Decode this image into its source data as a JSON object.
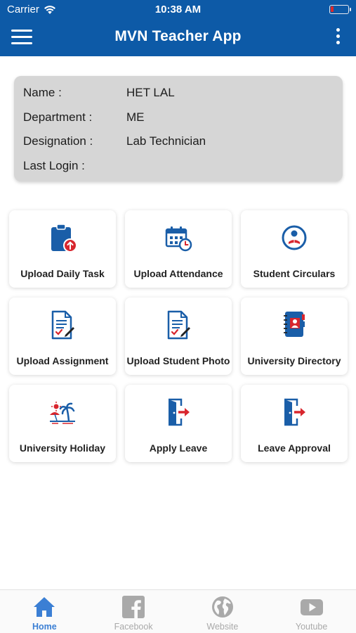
{
  "status": {
    "carrier": "Carrier",
    "time": "10:38 AM"
  },
  "header": {
    "title": "MVN Teacher App"
  },
  "profile": {
    "rows": [
      {
        "label": "Name :",
        "value": "HET LAL"
      },
      {
        "label": "Department :",
        "value": "ME"
      },
      {
        "label": "Designation :",
        "value": "Lab Technician"
      },
      {
        "label": "Last Login :",
        "value": ""
      }
    ]
  },
  "tiles": [
    {
      "label": "Upload Daily Task",
      "icon": "clipboard-upload-icon"
    },
    {
      "label": "Upload Attendance",
      "icon": "calendar-clock-icon"
    },
    {
      "label": "Student Circulars",
      "icon": "student-reading-icon"
    },
    {
      "label": "Upload Assignment",
      "icon": "document-edit-icon"
    },
    {
      "label": "Upload Student Photo",
      "icon": "document-edit-icon"
    },
    {
      "label": "University Directory",
      "icon": "directory-book-icon"
    },
    {
      "label": "University Holiday",
      "icon": "beach-holiday-icon"
    },
    {
      "label": "Apply Leave",
      "icon": "exit-door-icon"
    },
    {
      "label": "Leave Approval",
      "icon": "exit-door-icon"
    }
  ],
  "tabs": [
    {
      "label": "Home",
      "icon": "home-icon",
      "active": true
    },
    {
      "label": "Facebook",
      "icon": "facebook-icon",
      "active": false
    },
    {
      "label": "Website",
      "icon": "globe-icon",
      "active": false
    },
    {
      "label": "Youtube",
      "icon": "youtube-icon",
      "active": false
    }
  ],
  "colors": {
    "primary": "#0d5aa7",
    "icon_blue": "#1a5ea8",
    "icon_red": "#d8262e",
    "tab_active": "#3b7fd4",
    "tab_inactive": "#a9a9a9",
    "card_bg": "#d6d6d6"
  }
}
